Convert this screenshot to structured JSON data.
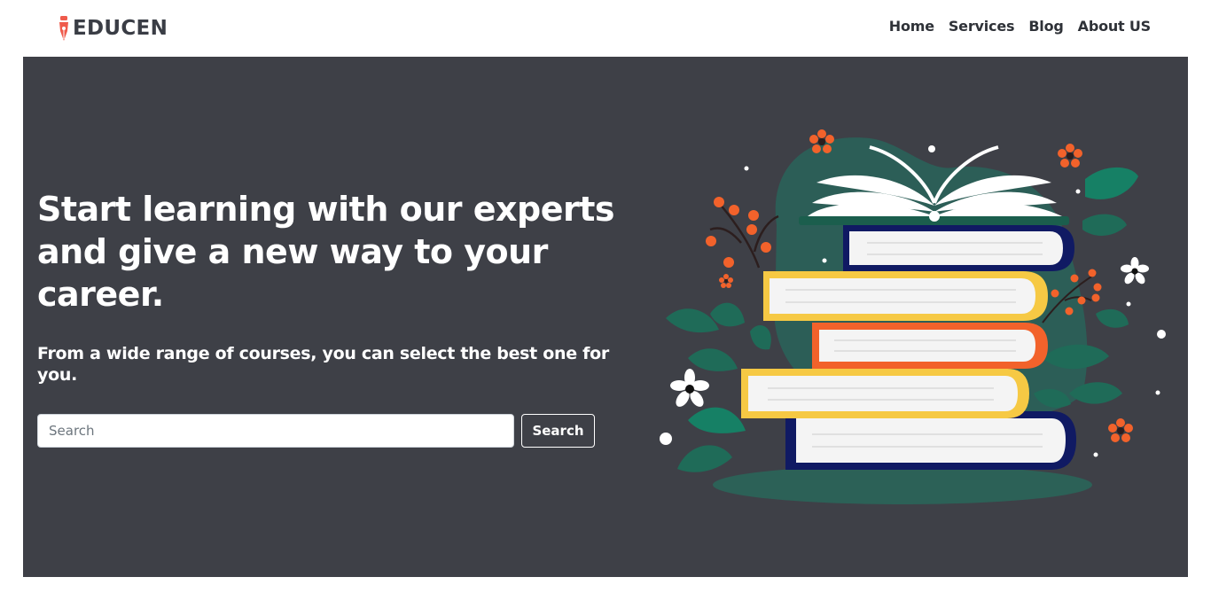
{
  "brand": {
    "name": "EDUCEN",
    "icon": "pen-nib-icon",
    "icon_color": "#ef5b4c"
  },
  "nav": {
    "items": [
      {
        "label": "Home"
      },
      {
        "label": "Services"
      },
      {
        "label": "Blog"
      },
      {
        "label": "About US"
      }
    ]
  },
  "hero": {
    "background": "#3e4047",
    "title": "Start learning with our experts and give a new way to your career.",
    "subtitle": "From a wide range of courses, you can select the best one for you.",
    "search": {
      "placeholder": "Search",
      "button_label": "Search"
    },
    "illustration": "stack-of-books-illustration"
  },
  "colors": {
    "accent_orange": "#f2622b",
    "accent_yellow": "#f6c944",
    "accent_navy": "#101a63",
    "accent_green": "#137a63"
  }
}
